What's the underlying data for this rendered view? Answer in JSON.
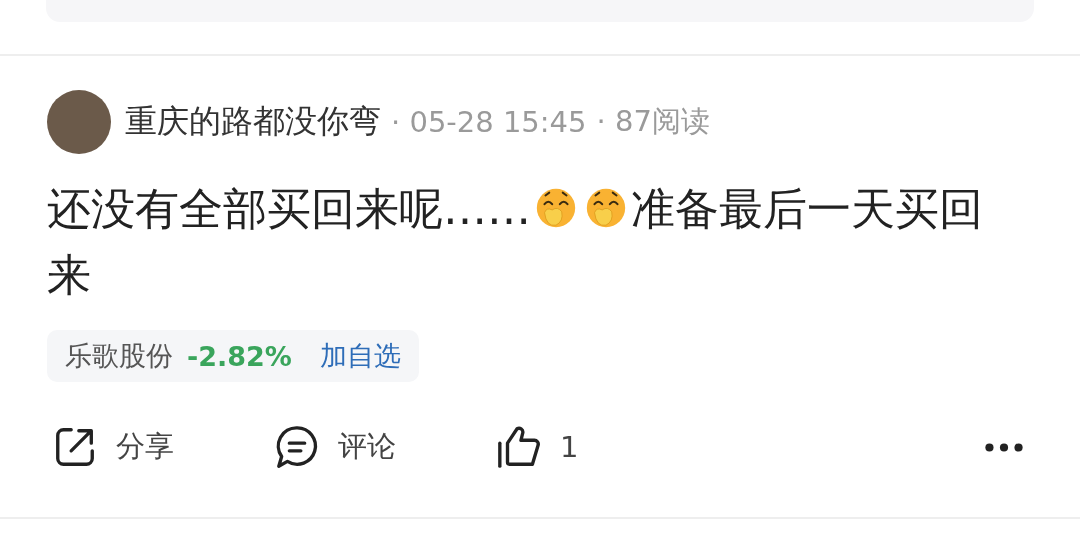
{
  "post": {
    "author": "重庆的路都没你弯",
    "time": "· 05-28 15:45",
    "reads": "· 87阅读",
    "content": [
      {
        "kind": "text",
        "text": "还没有全部买回来呢……"
      },
      {
        "kind": "emoji"
      },
      {
        "kind": "emoji"
      },
      {
        "kind": "text",
        "text": "准备最后一天买回"
      },
      {
        "kind": "text",
        "text": "来"
      }
    ],
    "stock": {
      "name": "乐歌股份",
      "change": "-2.82%",
      "color": "#3aa55c",
      "action": "加自选"
    },
    "actions": [
      {
        "kind": "share",
        "label": "分享"
      },
      {
        "kind": "comment",
        "label": "评论"
      },
      {
        "kind": "like",
        "label": "1"
      }
    ]
  }
}
